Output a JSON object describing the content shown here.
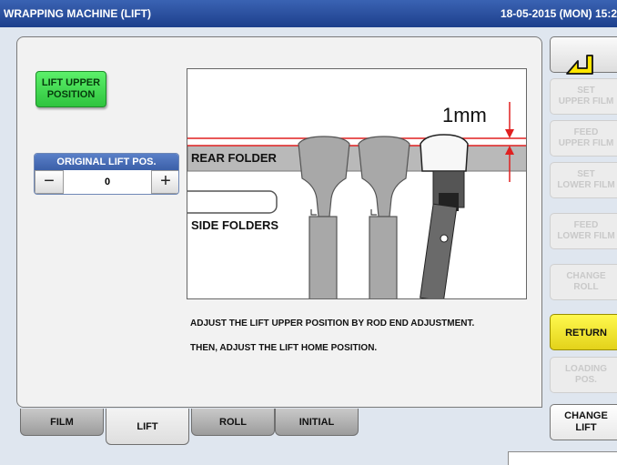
{
  "header": {
    "title": "WRAPPING MACHINE (LIFT)",
    "datetime": "18-05-2015 (MON) 15:2"
  },
  "left_panel": {
    "lift_upper_button": "LIFT UPPER\nPOSITION",
    "original_lift": {
      "label": "ORIGINAL LIFT POS.",
      "value": "0",
      "minus": "−",
      "plus": "+"
    }
  },
  "diagram": {
    "measure": "1mm",
    "rear_folder": "REAR FOLDER",
    "side_folders": "SIDE FOLDERS"
  },
  "instructions": [
    "ADJUST THE LIFT UPPER POSITION BY ROD END ADJUSTMENT.",
    "THEN, ADJUST THE LIFT HOME POSITION."
  ],
  "tabs": [
    {
      "label": "FILM",
      "active": false
    },
    {
      "label": "LIFT",
      "active": true
    },
    {
      "label": "ROLL",
      "active": false
    },
    {
      "label": "INITIAL",
      "active": false
    }
  ],
  "right_buttons": {
    "set_upper": "SET\nUPPER FILM",
    "feed_upper": "FEED\nUPPER FILM",
    "set_lower": "SET\nLOWER FILM",
    "feed_lower": "FEED\nLOWER FILM",
    "change_roll": "CHANGE\nROLL",
    "return": "RETURN",
    "loading": "LOADING\nPOS.",
    "change_lift": "CHANGE\nLIFT"
  },
  "icons": {
    "back": "back-arrow-icon"
  },
  "colors": {
    "title_bar": "#1d3f8c",
    "green_button": "#2fc43e",
    "yellow_button": "#e3d21a",
    "indicator_red": "#e02020"
  }
}
